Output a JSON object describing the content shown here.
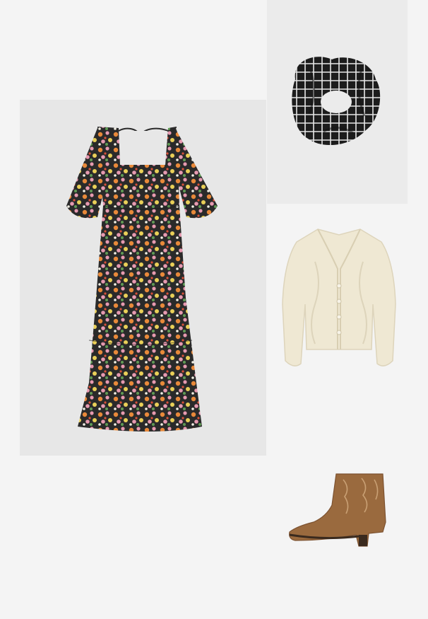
{
  "outfit": {
    "items": [
      {
        "id": "dress",
        "icon": "floral-midi-dress-icon"
      },
      {
        "id": "scrunchie",
        "icon": "checked-scrunchie-icon"
      },
      {
        "id": "cardigan",
        "icon": "cream-cable-knit-cardigan-icon"
      },
      {
        "id": "boot",
        "icon": "tan-western-ankle-boot-icon"
      }
    ]
  },
  "colors": {
    "page_background": "#f4f4f4",
    "dress_panel": "#e7e7e7",
    "scrunchie_panel": "#ebebeb",
    "dress_base": "#2a2a2a",
    "dress_flower_orange": "#e8893a",
    "dress_flower_pink": "#e79ab0",
    "dress_flower_yellow": "#e9cf58",
    "dress_flower_green": "#5f9a54",
    "scrunchie": "#1c1c1c",
    "cardigan": "#efe8d3",
    "boot": "#9a6a3e"
  }
}
